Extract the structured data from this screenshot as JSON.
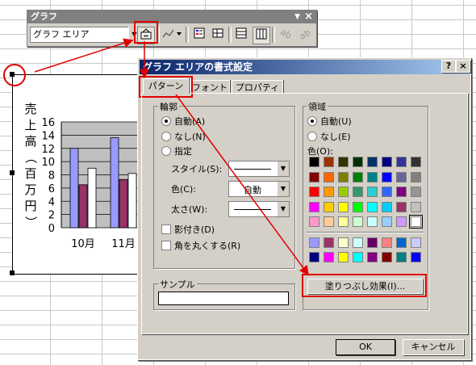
{
  "toolbar": {
    "title": "グラフ",
    "close_glyph": "×",
    "chart_object_selected": "グラフ エリア",
    "buttons": [
      "format-selected-object",
      "chart-type",
      "legend",
      "data-table",
      "by-row",
      "by-column",
      "angle-text-downward",
      "angle-text-upward"
    ]
  },
  "chart": {
    "ylabel": "売上高（百万円）",
    "ylabel_chars": [
      "売",
      "上",
      "高",
      "（",
      "百",
      "万",
      "円",
      "）"
    ],
    "yticks": [
      "16",
      "14",
      "12",
      "10",
      "8",
      "6",
      "4",
      "2",
      "0"
    ],
    "xlabels": [
      "10月",
      "11月"
    ]
  },
  "chart_data": {
    "type": "bar",
    "categories": [
      "10月",
      "11月"
    ],
    "series": [
      {
        "values": [
          12,
          13.6
        ],
        "color": "#9999ff"
      },
      {
        "values": [
          6.5,
          7.3
        ],
        "color": "#993366"
      },
      {
        "values": [
          9,
          8.2
        ],
        "color": "#ffffff"
      }
    ],
    "ylabel": "売上高（百万円）",
    "ylim": [
      0,
      16
    ],
    "grid": true
  },
  "dialog": {
    "title": "グラフ エリアの書式設定",
    "help_btn": "?",
    "close_btn": "×",
    "tabs": [
      "パターン",
      "フォント",
      "プロパティ"
    ],
    "border_group": {
      "label": "輪郭",
      "radios": [
        "自動(A)",
        "なし(N)",
        "指定"
      ],
      "selected_index": 0,
      "style_label": "スタイル(S):",
      "color_label": "色(C):",
      "color_value": "自動",
      "weight_label": "太さ(W):",
      "shadow_label": "影付き(D)",
      "round_label": "角を丸くする(R)"
    },
    "area_group": {
      "label": "領域",
      "radios": [
        "自動(U)",
        "なし(E)"
      ],
      "selected_index": 0,
      "color_label": "色(O):",
      "fill_button": "塗りつぶし効果(I)..."
    },
    "sample_label": "サンプル",
    "ok_label": "OK",
    "cancel_label": "キャンセル",
    "palette_main": [
      "#000000",
      "#993300",
      "#333300",
      "#003300",
      "#003366",
      "#000080",
      "#333399",
      "#333333",
      "#800000",
      "#ff6600",
      "#808000",
      "#008000",
      "#008080",
      "#0000ff",
      "#666699",
      "#808080",
      "#ff0000",
      "#ff9900",
      "#99cc00",
      "#339966",
      "#33cccc",
      "#3366ff",
      "#800080",
      "#969696",
      "#ff00ff",
      "#ffcc00",
      "#ffff00",
      "#00ff00",
      "#00ffff",
      "#00ccff",
      "#993366",
      "#c0c0c0",
      "#ff99cc",
      "#ffcc99",
      "#ffff99",
      "#ccffcc",
      "#ccffff",
      "#99ccff",
      "#cc99ff",
      "#ffffff"
    ],
    "palette_extra": [
      "#9999ff",
      "#993366",
      "#ffffcc",
      "#ccffff",
      "#660066",
      "#ff8080",
      "#0066cc",
      "#ccccff",
      "#000080",
      "#ff00ff",
      "#ffff00",
      "#00ffff",
      "#800080",
      "#800000",
      "#008080",
      "#0000ff"
    ],
    "accent_red": "#e00000"
  }
}
